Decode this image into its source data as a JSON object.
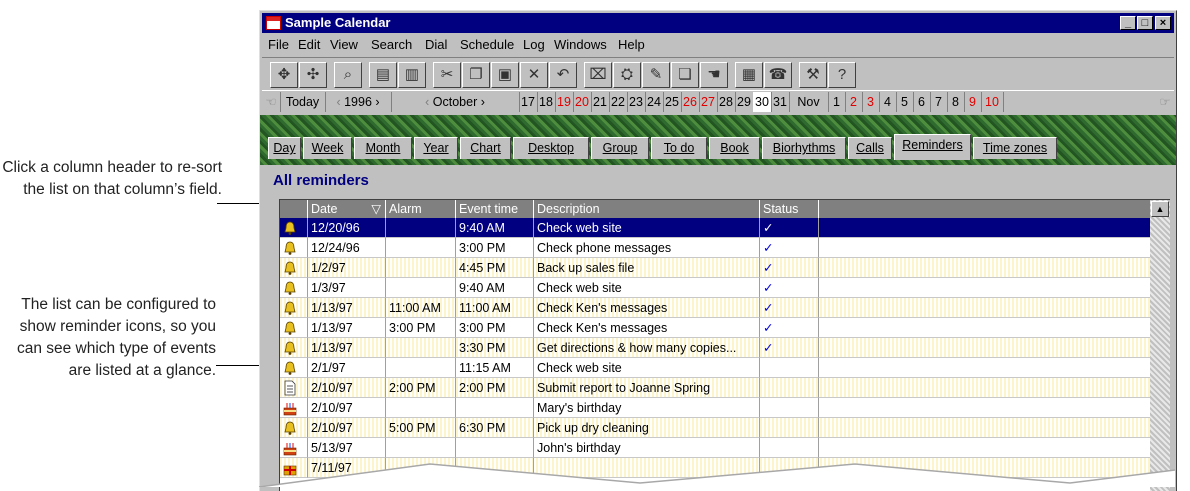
{
  "callouts": {
    "sort_note": "Click a column header to re-sort the list on that column’s field.",
    "icons_note": "The list can be configured to show reminder icons, so you can see which type of events are listed at a glance."
  },
  "window": {
    "title": "Sample Calendar",
    "controls": {
      "minimize": "_",
      "maximize": "□",
      "close": "×"
    }
  },
  "menu": [
    "File",
    "Edit",
    "View",
    "Search",
    "Dial",
    "Schedule",
    "Log",
    "Windows",
    "Help"
  ],
  "toolbar": {
    "buttons": [
      "move-icon",
      "drag-icon",
      "find-icon",
      "print-icon",
      "delete-icon",
      "cut-icon",
      "copy-icon",
      "paste-icon",
      "x-icon",
      "undo-icon",
      "card-icon",
      "lamp-icon",
      "note-icon",
      "pages-icon",
      "hand-icon",
      "calendar-icon",
      "phone-icon",
      "tools-icon",
      "help-icon"
    ],
    "help_label": "?"
  },
  "datebar": {
    "today": "Today",
    "year": "1996",
    "month": "October",
    "october_days": [
      "17",
      "18",
      "19",
      "20",
      "21",
      "22",
      "23",
      "24",
      "25",
      "26",
      "27",
      "28",
      "29",
      "30",
      "31"
    ],
    "next_month": "Nov",
    "november_days": [
      "1",
      "2",
      "3",
      "4",
      "5",
      "6",
      "7",
      "8",
      "9",
      "10"
    ],
    "weekend_color": "#e00000",
    "selected_day": "30"
  },
  "tabs": [
    "Day",
    "Week",
    "Month",
    "Year",
    "Chart",
    "Desktop",
    "Group",
    "To do",
    "Book",
    "Biorhythms",
    "Calls",
    "Reminders",
    "Time zones"
  ],
  "active_tab": "Reminders",
  "list": {
    "title": "All reminders",
    "columns": [
      "",
      "Date",
      "Alarm",
      "Event time",
      "Description",
      "Status"
    ],
    "sort_indicator": "▽",
    "rows": [
      {
        "icon": "bell-icon",
        "date": "12/20/96",
        "alarm": "",
        "time": "9:40 AM",
        "desc": "Check web site",
        "status": "✓"
      },
      {
        "icon": "bell-icon",
        "date": "12/24/96",
        "alarm": "",
        "time": "3:00 PM",
        "desc": "Check phone messages",
        "status": "✓"
      },
      {
        "icon": "bell-icon",
        "date": "1/2/97",
        "alarm": "",
        "time": "4:45 PM",
        "desc": "Back up sales file",
        "status": "✓"
      },
      {
        "icon": "bell-icon",
        "date": "1/3/97",
        "alarm": "",
        "time": "9:40 AM",
        "desc": "Check web site",
        "status": "✓"
      },
      {
        "icon": "bell-icon",
        "date": "1/13/97",
        "alarm": "11:00 AM",
        "time": "11:00 AM",
        "desc": "Check Ken's messages",
        "status": "✓"
      },
      {
        "icon": "bell-icon",
        "date": "1/13/97",
        "alarm": "3:00 PM",
        "time": "3:00 PM",
        "desc": "Check Ken's messages",
        "status": "✓"
      },
      {
        "icon": "bell-icon",
        "date": "1/13/97",
        "alarm": "",
        "time": "3:30 PM",
        "desc": "Get directions & how many copies...",
        "status": "✓"
      },
      {
        "icon": "bell-icon",
        "date": "2/1/97",
        "alarm": "",
        "time": "11:15 AM",
        "desc": "Check web site",
        "status": ""
      },
      {
        "icon": "document-icon",
        "date": "2/10/97",
        "alarm": "2:00 PM",
        "time": "2:00 PM",
        "desc": "Submit report to Joanne Spring",
        "status": ""
      },
      {
        "icon": "cake-icon",
        "date": "2/10/97",
        "alarm": "",
        "time": "",
        "desc": "Mary's birthday",
        "status": ""
      },
      {
        "icon": "bell-icon",
        "date": "2/10/97",
        "alarm": "5:00 PM",
        "time": "6:30 PM",
        "desc": "Pick up dry cleaning",
        "status": ""
      },
      {
        "icon": "cake-icon",
        "date": "5/13/97",
        "alarm": "",
        "time": "",
        "desc": "John's birthday",
        "status": ""
      },
      {
        "icon": "gift-icon",
        "date": "7/11/97",
        "alarm": "",
        "time": "",
        "desc": "",
        "status": ""
      }
    ]
  }
}
